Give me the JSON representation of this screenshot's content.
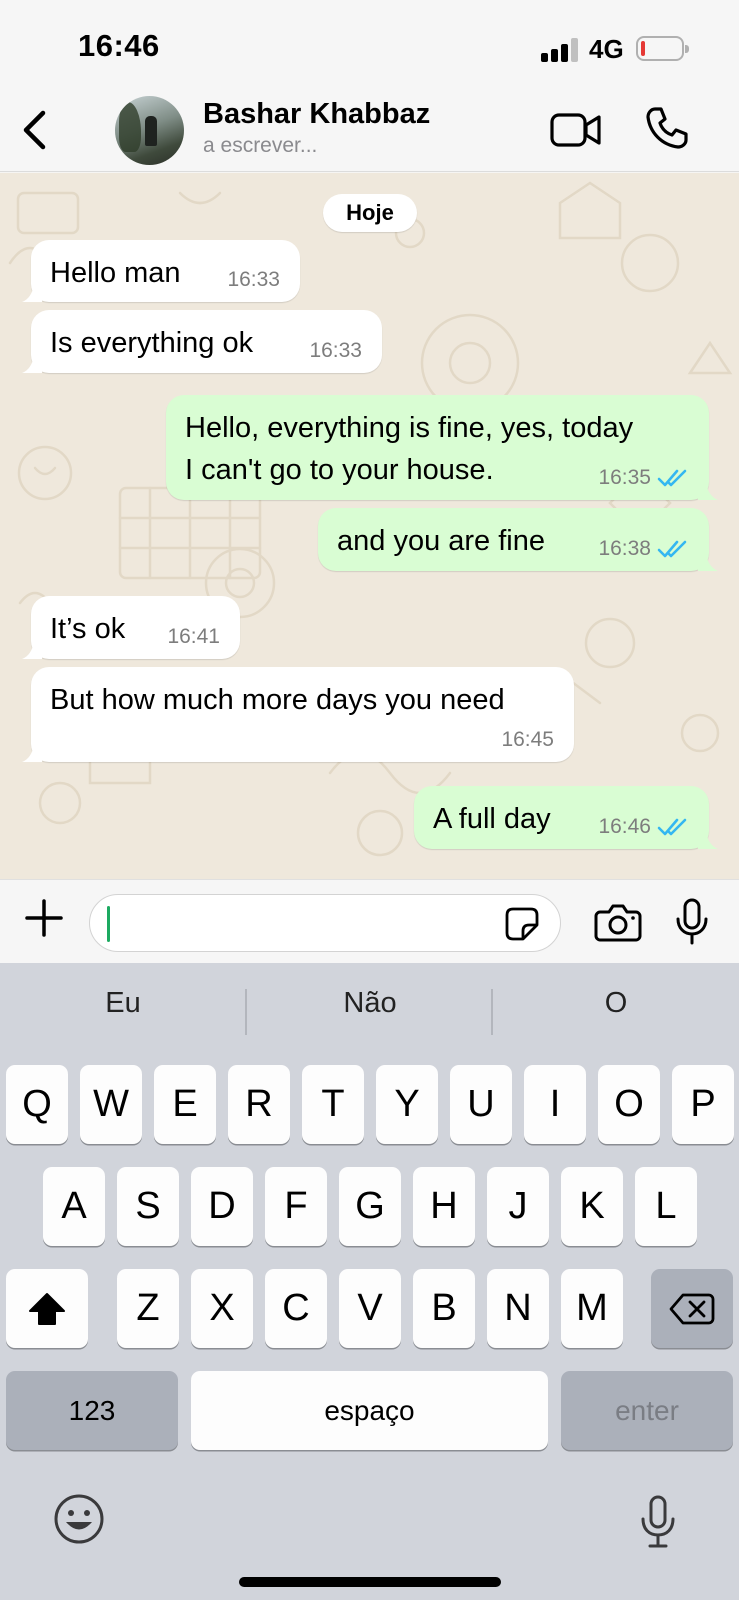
{
  "status_bar": {
    "time": "16:46",
    "network": "4G",
    "battery_level": 0.1,
    "signal_bars": 4
  },
  "header": {
    "contact_name": "Bashar Khabbaz",
    "contact_status": "a escrever...",
    "icons": [
      "back-chevron-icon",
      "video-call-icon",
      "voice-call-icon"
    ]
  },
  "chat": {
    "date_chip": "Hoje",
    "messages": [
      {
        "direction": "in",
        "text": "Hello man",
        "time": "16:33"
      },
      {
        "direction": "in",
        "text": "Is everything ok",
        "time": "16:33"
      },
      {
        "direction": "out",
        "text": "Hello, everything is fine, yes, today\nI can't go to your house.",
        "time": "16:35",
        "status": "read"
      },
      {
        "direction": "out",
        "text": "and you are fine",
        "time": "16:38",
        "status": "read"
      },
      {
        "direction": "in",
        "text": "It’s ok",
        "time": "16:41"
      },
      {
        "direction": "in",
        "text": "But how much more days you need",
        "time": "16:45"
      },
      {
        "direction": "out",
        "text": "A full day",
        "time": "16:46",
        "status": "read"
      }
    ],
    "colors": {
      "incoming": "#ffffff",
      "outgoing": "#d9fdd3",
      "read_ticks": "#34b7f1",
      "wallpaper": "#efe8dc"
    }
  },
  "composer": {
    "input_value": "",
    "icons": [
      "plus-icon",
      "sticker-icon",
      "camera-icon",
      "microphone-icon"
    ],
    "caret_color": "#1daa61"
  },
  "keyboard": {
    "suggestions": [
      "Eu",
      "Não",
      "O"
    ],
    "rows": [
      [
        "Q",
        "W",
        "E",
        "R",
        "T",
        "Y",
        "U",
        "I",
        "O",
        "P"
      ],
      [
        "A",
        "S",
        "D",
        "F",
        "G",
        "H",
        "J",
        "K",
        "L"
      ],
      [
        "Z",
        "X",
        "C",
        "V",
        "B",
        "N",
        "M"
      ]
    ],
    "numbers_key": "123",
    "space_key": "espaço",
    "enter_key": "enter",
    "icons": [
      "shift-icon",
      "backspace-icon",
      "emoji-icon",
      "dictation-mic-icon"
    ]
  }
}
